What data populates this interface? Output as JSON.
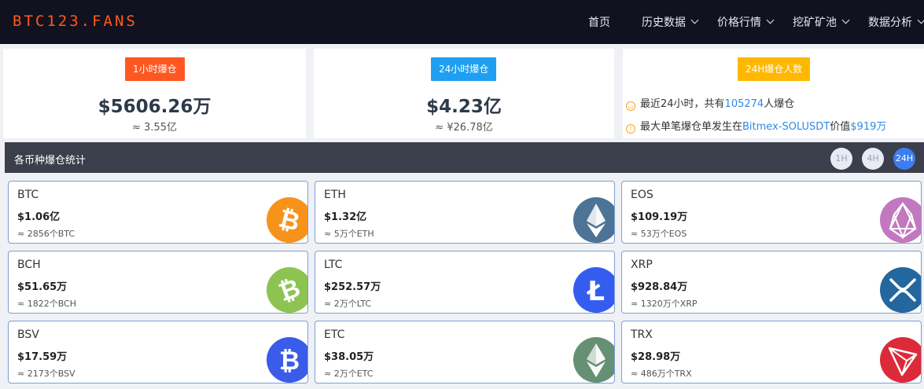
{
  "header": {
    "logo": "BTC123.FANS",
    "nav": [
      {
        "label": "首页",
        "dropdown": false
      },
      {
        "label": "历史数据",
        "dropdown": true
      },
      {
        "label": "价格行情",
        "dropdown": true
      },
      {
        "label": "挖矿矿池",
        "dropdown": true
      },
      {
        "label": "数据分析",
        "dropdown": true
      }
    ]
  },
  "stats": {
    "hour1": {
      "label": "1小时爆仓",
      "value": "$5606.26万",
      "sub": "≈ 3.55亿",
      "color": "#ff5722"
    },
    "hour24": {
      "label": "24小时爆仓",
      "value": "$4.23亿",
      "sub": "≈ ¥26.78亿",
      "color": "#1e9ff2"
    },
    "people": {
      "label": "24H爆仓人数",
      "color": "#ffb800",
      "line1_pre": "最近24小时，共有",
      "line1_num": "105274",
      "line1_post": "人爆仓",
      "line2_pre": "最大单笔爆仓单发生在",
      "line2_pair": "Bitmex-SOLUSDT",
      "line2_mid": "价值",
      "line2_val": "$919万"
    }
  },
  "section": {
    "title": "各币种爆仓统计",
    "buttons": [
      "1H",
      "4H",
      "24H"
    ],
    "active": "24H"
  },
  "coins": [
    {
      "symbol": "BTC",
      "value": "$1.06亿",
      "count": "≈ 2856个BTC",
      "icon": "bitcoin-icon",
      "color": "#f7931a"
    },
    {
      "symbol": "ETH",
      "value": "$1.32亿",
      "count": "≈ 5万个ETH",
      "icon": "ethereum-icon",
      "color": "#4d7396"
    },
    {
      "symbol": "EOS",
      "value": "$109.19万",
      "count": "≈ 53万个EOS",
      "icon": "eos-icon",
      "color": "#c278bf"
    },
    {
      "symbol": "BCH",
      "value": "$51.65万",
      "count": "≈ 1822个BCH",
      "icon": "bitcoin-cash-icon",
      "color": "#8dc351"
    },
    {
      "symbol": "LTC",
      "value": "$252.57万",
      "count": "≈ 2万个LTC",
      "icon": "litecoin-icon",
      "color": "#345df0"
    },
    {
      "symbol": "XRP",
      "value": "$928.84万",
      "count": "≈ 1320万个XRP",
      "icon": "xrp-icon",
      "color": "#23679e"
    },
    {
      "symbol": "BSV",
      "value": "$17.59万",
      "count": "≈ 2173个BSV",
      "icon": "bitcoin-sv-icon",
      "color": "#3a5ce8"
    },
    {
      "symbol": "ETC",
      "value": "$38.05万",
      "count": "≈ 2万个ETC",
      "icon": "ethereum-classic-icon",
      "color": "#669073"
    },
    {
      "symbol": "TRX",
      "value": "$28.98万",
      "count": "≈ 486万个TRX",
      "icon": "tron-icon",
      "color": "#dd2a38"
    }
  ]
}
